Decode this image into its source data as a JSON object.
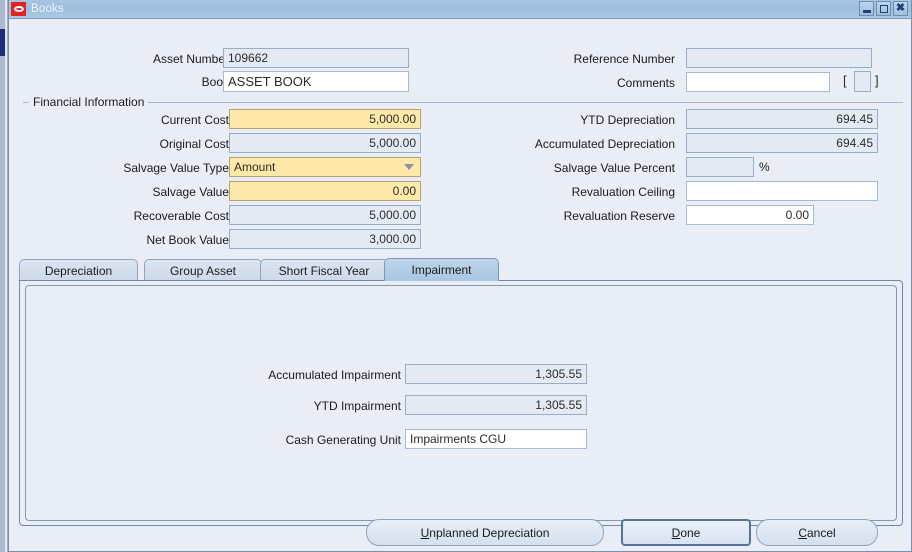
{
  "window": {
    "title": "Books",
    "app_icon": "oracle-logo-icon",
    "controls": {
      "minimize": "minimize-icon",
      "maximize": "maximize-icon",
      "close": "close-icon"
    }
  },
  "header_fields": {
    "asset_number": {
      "label": "Asset Number",
      "value": "109662",
      "readonly": true
    },
    "book": {
      "label": "Book",
      "value": "ASSET BOOK",
      "readonly": false
    },
    "reference_number": {
      "label": "Reference Number",
      "value": "",
      "readonly": true
    },
    "comments": {
      "label": "Comments",
      "value": "",
      "readonly": false,
      "bracket_open": "[",
      "bracket_close": "]"
    }
  },
  "financial_information": {
    "group_label": "Financial Information",
    "left": [
      {
        "label": "Current Cost",
        "value": "5,000.00",
        "style": "required"
      },
      {
        "label": "Original Cost",
        "value": "5,000.00",
        "style": "readonly"
      },
      {
        "label": "Salvage Value Type",
        "value": "Amount",
        "style": "combo"
      },
      {
        "label": "Salvage Value",
        "value": "0.00",
        "style": "required"
      },
      {
        "label": "Recoverable Cost",
        "value": "5,000.00",
        "style": "readonly"
      },
      {
        "label": "Net Book Value",
        "value": "3,000.00",
        "style": "readonly"
      }
    ],
    "right": [
      {
        "label": "YTD Depreciation",
        "value": "694.45",
        "style": "readonly"
      },
      {
        "label": "Accumulated Depreciation",
        "value": "694.45",
        "style": "readonly"
      },
      {
        "label": "Salvage Value Percent",
        "value": "",
        "style": "readonly",
        "suffix": "%"
      },
      {
        "label": "Revaluation Ceiling",
        "value": "",
        "style": "editable"
      },
      {
        "label": "Revaluation Reserve",
        "value": "0.00",
        "style": "editable"
      }
    ]
  },
  "tabs": [
    {
      "label": "Depreciation",
      "active": false
    },
    {
      "label": "Group Asset",
      "active": false
    },
    {
      "label": "Short Fiscal Year",
      "active": false
    },
    {
      "label": "Impairment",
      "active": true
    }
  ],
  "impairment_tab": {
    "fields": [
      {
        "label": "Accumulated Impairment",
        "value": "1,305.55",
        "style": "readonly"
      },
      {
        "label": "YTD Impairment",
        "value": "1,305.55",
        "style": "readonly"
      },
      {
        "label": "Cash Generating Unit",
        "value": "Impairments CGU",
        "style": "editable"
      }
    ]
  },
  "footer_buttons": {
    "unplanned_depreciation": {
      "mnemonic": "U",
      "rest": "nplanned Depreciation"
    },
    "done": {
      "mnemonic": "D",
      "rest": "one"
    },
    "cancel": {
      "mnemonic": "C",
      "rest": "ancel"
    }
  },
  "colors": {
    "titlebar": "#9dbedd",
    "required_field": "#ffe9a8",
    "readonly_field": "#e4eaf3",
    "editable_field": "#ffffff",
    "window_bg": "#e9eef6",
    "active_tab": "#a9c6e2",
    "oracle_red": "#e32322"
  }
}
